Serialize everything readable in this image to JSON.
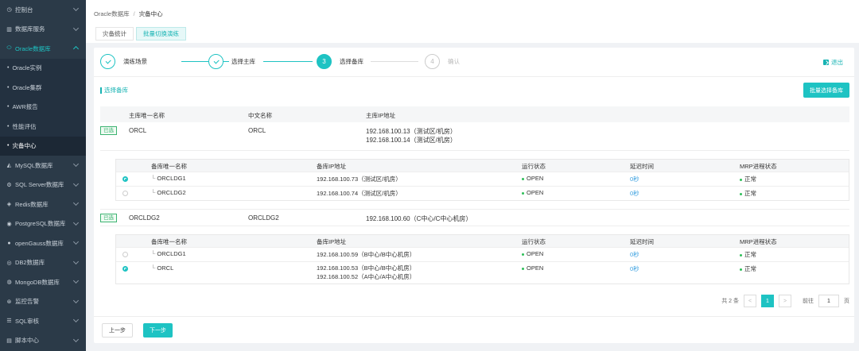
{
  "sidebar": {
    "items": [
      {
        "label": "控制台",
        "icon": "dashboard-icon"
      },
      {
        "label": "数据库服务",
        "icon": "database-service-icon"
      },
      {
        "label": "Oracle数据库",
        "icon": "oracle-icon"
      },
      {
        "label": "MySQL数据库",
        "icon": "mysql-icon"
      },
      {
        "label": "SQL Server数据库",
        "icon": "sqlserver-icon"
      },
      {
        "label": "Redis数据库",
        "icon": "redis-icon"
      },
      {
        "label": "PostgreSQL数据库",
        "icon": "postgresql-icon"
      },
      {
        "label": "openGauss数据库",
        "icon": "opengauss-icon"
      },
      {
        "label": "DB2数据库",
        "icon": "db2-icon"
      },
      {
        "label": "MongoDB数据库",
        "icon": "mongodb-icon"
      },
      {
        "label": "监控告警",
        "icon": "alarm-icon"
      },
      {
        "label": "SQL审核",
        "icon": "sql-audit-icon"
      },
      {
        "label": "脚本中心",
        "icon": "script-icon"
      }
    ],
    "oracle_sub": [
      "Oracle实例",
      "Oracle集群",
      "AWR报告",
      "性能评估",
      "灾备中心"
    ]
  },
  "breadcrumb": {
    "root": "Oracle数据库",
    "sep": "/",
    "current": "灾备中心"
  },
  "tabs": [
    "灾备统计",
    "批量切换演练"
  ],
  "steps": [
    {
      "label": "演练场景"
    },
    {
      "label": "选择主库"
    },
    {
      "num": "3",
      "label": "选择备库"
    },
    {
      "num": "4",
      "label": "确认"
    }
  ],
  "exit_label": "退出",
  "section_title": "选择备库",
  "batch_button": "批量选择备库",
  "primary_headers": [
    "主库唯一名称",
    "中文名称",
    "主库IP地址"
  ],
  "primary_rows": [
    {
      "tag": "已选",
      "name": "ORCL",
      "cn_name": "ORCL",
      "ips": [
        "192.168.100.13（测试区/机房）",
        "192.168.100.14（测试区/机房）"
      ],
      "standby_headers": [
        "备库唯一名称",
        "备库IP地址",
        "运行状态",
        "延迟时间",
        "MRP进程状态"
      ],
      "standbys": [
        {
          "name": "ORCLDG1",
          "ips": [
            "192.168.100.73（测试区/机房）"
          ],
          "status": "OPEN",
          "delay": "0秒",
          "mrp": "正常"
        },
        {
          "name": "ORCLDG2",
          "ips": [
            "192.168.100.74（测试区/机房）"
          ],
          "status": "OPEN",
          "delay": "0秒",
          "mrp": "正常"
        }
      ]
    },
    {
      "tag": "已选",
      "name": "ORCLDG2",
      "cn_name": "ORCLDG2",
      "ips": [
        "192.168.100.60（C中心/C中心机房）"
      ],
      "standby_headers": [
        "备库唯一名称",
        "备库IP地址",
        "运行状态",
        "延迟时间",
        "MRP进程状态"
      ],
      "standbys": [
        {
          "name": "ORCLDG1",
          "ips": [
            "192.168.100.59（B中心/B中心机房）"
          ],
          "status": "OPEN",
          "delay": "0秒",
          "mrp": "正常"
        },
        {
          "name": "ORCL",
          "ips": [
            "192.168.100.53（B中心/B中心机房）",
            "192.168.100.52（A中心/A中心机房）"
          ],
          "status": "OPEN",
          "delay": "0秒",
          "mrp": "正常"
        }
      ]
    }
  ],
  "pager": {
    "total": "共 2 条",
    "prev": "<",
    "page": "1",
    "next": ">",
    "goto": "前往",
    "goto_value": "1",
    "unit": "页"
  },
  "buttons": {
    "prev": "上一步",
    "next": "下一步"
  },
  "colors": {
    "accent": "#1ec3c3",
    "sidebar_bg": "#2b3a48",
    "ok_green": "#2fbf5a",
    "delay_blue": "#3aa0e0"
  }
}
